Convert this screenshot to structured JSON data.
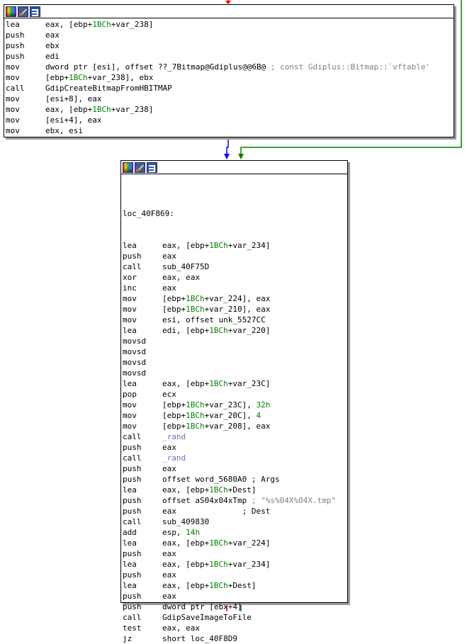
{
  "colors": {
    "background": "#ffffff",
    "block_border": "#000000",
    "text": "#000000",
    "number": "#008000",
    "comment": "#808080",
    "library_function": "#7070c0",
    "edge_taken": "#0000ff",
    "edge_fallthrough": "#008000",
    "edge_false": "#ff0000"
  },
  "titlebar_icons": [
    "graph-color-icon",
    "edit-block-icon",
    "graph-overview-icon"
  ],
  "block1": {
    "lines": [
      {
        "m": "lea",
        "ops": [
          {
            "t": "eax, [ebp+"
          },
          {
            "t": "1BCh",
            "k": "num"
          },
          {
            "t": "+var_238]"
          }
        ]
      },
      {
        "m": "push",
        "ops": [
          {
            "t": "eax"
          }
        ]
      },
      {
        "m": "push",
        "ops": [
          {
            "t": "ebx"
          }
        ]
      },
      {
        "m": "push",
        "ops": [
          {
            "t": "edi"
          }
        ]
      },
      {
        "m": "mov",
        "ops": [
          {
            "t": "dword ptr [esi], offset ??_7Bitmap@Gdiplus@@6B@ "
          },
          {
            "t": "; const Gdiplus::Bitmap::`vftable'",
            "k": "cmt"
          }
        ]
      },
      {
        "m": "mov",
        "ops": [
          {
            "t": "[ebp+"
          },
          {
            "t": "1BCh",
            "k": "num"
          },
          {
            "t": "+var_238], ebx"
          }
        ]
      },
      {
        "m": "call",
        "ops": [
          {
            "t": "GdipCreateBitmapFromHBITMAP"
          }
        ]
      },
      {
        "m": "mov",
        "ops": [
          {
            "t": "[esi+8], eax"
          }
        ]
      },
      {
        "m": "mov",
        "ops": [
          {
            "t": "eax, [ebp+"
          },
          {
            "t": "1BCh",
            "k": "num"
          },
          {
            "t": "+var_238]"
          }
        ]
      },
      {
        "m": "mov",
        "ops": [
          {
            "t": "[esi+4], eax"
          }
        ]
      },
      {
        "m": "mov",
        "ops": [
          {
            "t": "ebx, esi"
          }
        ]
      }
    ]
  },
  "block2": {
    "label": "loc_40F869:",
    "lines": [
      {
        "m": "lea",
        "ops": [
          {
            "t": "eax, [ebp+"
          },
          {
            "t": "1BCh",
            "k": "num"
          },
          {
            "t": "+var_234]"
          }
        ]
      },
      {
        "m": "push",
        "ops": [
          {
            "t": "eax"
          }
        ]
      },
      {
        "m": "call",
        "ops": [
          {
            "t": "sub_40F75D"
          }
        ]
      },
      {
        "m": "xor",
        "ops": [
          {
            "t": "eax, eax"
          }
        ]
      },
      {
        "m": "inc",
        "ops": [
          {
            "t": "eax"
          }
        ]
      },
      {
        "m": "mov",
        "ops": [
          {
            "t": "[ebp+"
          },
          {
            "t": "1BCh",
            "k": "num"
          },
          {
            "t": "+var_224], eax"
          }
        ]
      },
      {
        "m": "mov",
        "ops": [
          {
            "t": "[ebp+"
          },
          {
            "t": "1BCh",
            "k": "num"
          },
          {
            "t": "+var_210], eax"
          }
        ]
      },
      {
        "m": "mov",
        "ops": [
          {
            "t": "esi, offset unk_5527CC"
          }
        ]
      },
      {
        "m": "lea",
        "ops": [
          {
            "t": "edi, [ebp+"
          },
          {
            "t": "1BCh",
            "k": "num"
          },
          {
            "t": "+var_220]"
          }
        ]
      },
      {
        "m": "movsd",
        "ops": []
      },
      {
        "m": "movsd",
        "ops": []
      },
      {
        "m": "movsd",
        "ops": []
      },
      {
        "m": "movsd",
        "ops": []
      },
      {
        "m": "lea",
        "ops": [
          {
            "t": "eax, [ebp+"
          },
          {
            "t": "1BCh",
            "k": "num"
          },
          {
            "t": "+var_23C]"
          }
        ]
      },
      {
        "m": "pop",
        "ops": [
          {
            "t": "ecx"
          }
        ]
      },
      {
        "m": "mov",
        "ops": [
          {
            "t": "[ebp+"
          },
          {
            "t": "1BCh",
            "k": "num"
          },
          {
            "t": "+var_23C], "
          },
          {
            "t": "32h",
            "k": "num"
          }
        ]
      },
      {
        "m": "mov",
        "ops": [
          {
            "t": "[ebp+"
          },
          {
            "t": "1BCh",
            "k": "num"
          },
          {
            "t": "+var_20C], "
          },
          {
            "t": "4",
            "k": "num"
          }
        ]
      },
      {
        "m": "mov",
        "ops": [
          {
            "t": "[ebp+"
          },
          {
            "t": "1BCh",
            "k": "num"
          },
          {
            "t": "+var_208], eax"
          }
        ]
      },
      {
        "m": "call",
        "ops": [
          {
            "t": "_rand",
            "k": "fn"
          }
        ]
      },
      {
        "m": "push",
        "ops": [
          {
            "t": "eax"
          }
        ]
      },
      {
        "m": "call",
        "ops": [
          {
            "t": "_rand",
            "k": "fn"
          }
        ]
      },
      {
        "m": "push",
        "ops": [
          {
            "t": "eax"
          }
        ]
      },
      {
        "m": "push",
        "ops": [
          {
            "t": "offset word_5680A0 "
          },
          {
            "t": "; Args"
          }
        ]
      },
      {
        "m": "lea",
        "ops": [
          {
            "t": "eax, [ebp+"
          },
          {
            "t": "1BCh",
            "k": "num"
          },
          {
            "t": "+Dest]"
          }
        ]
      },
      {
        "m": "push",
        "ops": [
          {
            "t": "offset aS04x04xTmp "
          },
          {
            "t": "; \"%s%04X%04X.tmp\"",
            "k": "cmt"
          }
        ]
      },
      {
        "m": "push",
        "ops": [
          {
            "t": "eax              "
          },
          {
            "t": "; Dest"
          }
        ]
      },
      {
        "m": "call",
        "ops": [
          {
            "t": "sub_409830"
          }
        ]
      },
      {
        "m": "add",
        "ops": [
          {
            "t": "esp, "
          },
          {
            "t": "14h",
            "k": "num"
          }
        ]
      },
      {
        "m": "lea",
        "ops": [
          {
            "t": "eax, [ebp+"
          },
          {
            "t": "1BCh",
            "k": "num"
          },
          {
            "t": "+var_224]"
          }
        ]
      },
      {
        "m": "push",
        "ops": [
          {
            "t": "eax"
          }
        ]
      },
      {
        "m": "lea",
        "ops": [
          {
            "t": "eax, [ebp+"
          },
          {
            "t": "1BCh",
            "k": "num"
          },
          {
            "t": "+var_234]"
          }
        ]
      },
      {
        "m": "push",
        "ops": [
          {
            "t": "eax"
          }
        ]
      },
      {
        "m": "lea",
        "ops": [
          {
            "t": "eax, [ebp+"
          },
          {
            "t": "1BCh",
            "k": "num"
          },
          {
            "t": "+Dest]"
          }
        ]
      },
      {
        "m": "push",
        "ops": [
          {
            "t": "eax"
          }
        ]
      },
      {
        "m": "push",
        "ops": [
          {
            "t": "dword ptr [ebx+4]"
          }
        ]
      },
      {
        "m": "call",
        "ops": [
          {
            "t": "GdipSaveImageToFile"
          }
        ]
      },
      {
        "m": "test",
        "ops": [
          {
            "t": "eax, eax"
          }
        ]
      },
      {
        "m": "jz",
        "ops": [
          {
            "t": "short loc_40F8D9"
          }
        ]
      }
    ]
  }
}
